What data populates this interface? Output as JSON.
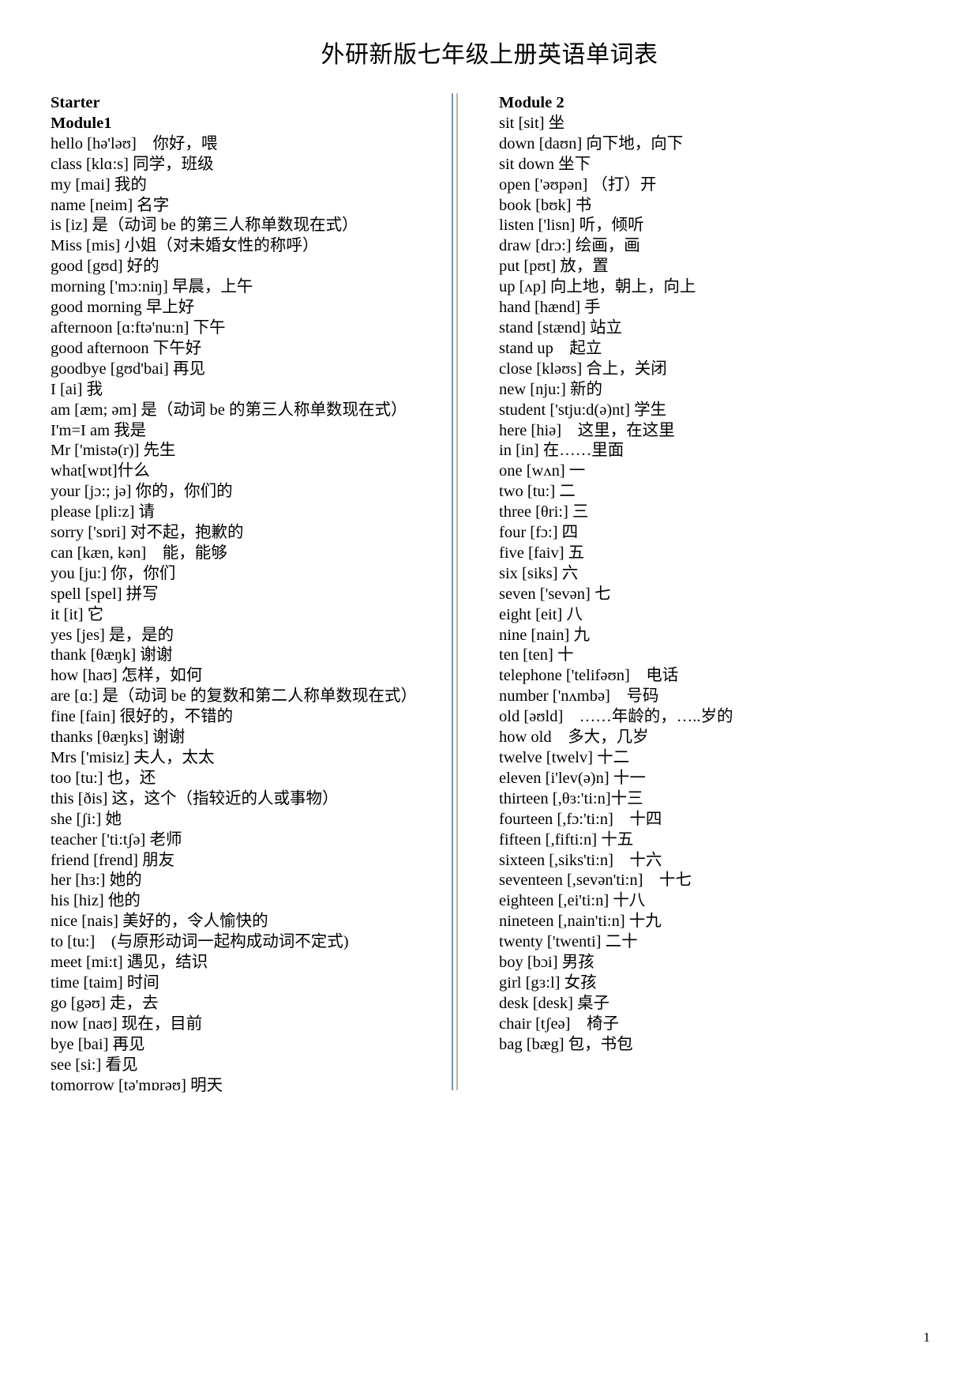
{
  "document": {
    "title": "外研新版七年级上册英语单词表",
    "page_number": "1",
    "divider_outer_color": "#6f96b8",
    "divider_inner_color": "#b4b4b4"
  },
  "left_column": {
    "headings": [
      "Starter",
      "Module1"
    ],
    "entries": [
      "hello [hə'ləʊ]　你好，喂",
      "class [klɑ:s] 同学，班级",
      "my [mai] 我的",
      "name [neim] 名字",
      "is [iz] 是（动词 be 的第三人称单数现在式）",
      "Miss [mis] 小姐（对未婚女性的称呼）",
      "good [gʊd] 好的",
      "morning ['mɔ:niŋ] 早晨，上午",
      "good morning 早上好",
      "afternoon [ɑ:ftə'nu:n] 下午",
      "good afternoon 下午好",
      "goodbye [gʊd'bai] 再见",
      "I [ai] 我",
      "am [æm; əm] 是（动词 be 的第三人称单数现在式）",
      "I'm=I am 我是",
      "Mr ['mistə(r)] 先生",
      "what[wɒt]什么",
      "your [jɔ:; jə] 你的，你们的",
      "please [pli:z] 请",
      "sorry ['sɒri] 对不起，抱歉的",
      "can [kæn, kən]　能，能够",
      "you [ju:] 你，你们",
      "spell [spel] 拼写",
      "it [it] 它",
      "yes [jes] 是，是的",
      "thank [θæŋk] 谢谢",
      "how [haʊ] 怎样，如何",
      "are [ɑ:] 是（动词 be 的复数和第二人称单数现在式）",
      "fine [fain] 很好的，不错的",
      "thanks [θæŋks] 谢谢",
      "Mrs ['misiz] 夫人，太太",
      "too [tu:] 也，还",
      "this [ðis] 这，这个（指较近的人或事物）",
      "she [ʃi:] 她",
      "teacher ['ti:tʃə] 老师",
      "friend [frend] 朋友",
      "her [hɜ:] 她的",
      "his [hiz] 他的",
      "nice [nais] 美好的，令人愉快的",
      "to [tu:]　(与原形动词一起构成动词不定式)",
      "meet [mi:t] 遇见，结识",
      "time [taim] 时间",
      "go [gəʊ] 走，去",
      "now [naʊ] 现在，目前",
      "bye [bai] 再见",
      "see [si:] 看见",
      "tomorrow [tə'mɒrəʊ] 明天"
    ]
  },
  "right_column": {
    "headings": [
      "Module 2"
    ],
    "entries": [
      "sit [sit] 坐",
      "down [daʊn] 向下地，向下",
      "sit down 坐下",
      "open ['əʊpən] （打）开",
      "book [bʊk] 书",
      "listen ['lisn] 听，倾听",
      "draw [drɔ:] 绘画，画",
      "put [pʊt] 放，置",
      "up [ʌp] 向上地，朝上，向上",
      "hand [hænd] 手",
      "stand [stænd] 站立",
      "stand up　起立",
      "close [kləʊs] 合上，关闭",
      "new [nju:] 新的",
      "student ['stju:d(ə)nt] 学生",
      "here [hiə]　这里，在这里",
      "in [in] 在……里面",
      "one [wʌn] 一",
      "two [tu:] 二",
      "three [θri:] 三",
      "four [fɔ:] 四",
      "five [faiv] 五",
      "six [siks] 六",
      "seven ['sevən] 七",
      "eight [eit] 八",
      "nine [nain] 九",
      "ten [ten] 十",
      "telephone ['telifəʊn]　电话",
      "number ['nʌmbə]　号码",
      "old [əʊld]　……年龄的，…..岁的",
      "how old　多大，几岁",
      "twelve [twelv] 十二",
      "eleven [i'lev(ə)n] 十一",
      "thirteen [,θɜ:'ti:n]十三",
      "fourteen [,fɔ:'ti:n]　十四",
      "fifteen [,fifti:n] 十五",
      "sixteen [,siks'ti:n]　十六",
      "seventeen [,sevən'ti:n]　十七",
      "eighteen [,ei'ti:n] 十八",
      "nineteen [,nain'ti:n] 十九",
      "twenty ['twenti] 二十",
      "boy [bɔi] 男孩",
      "girl [gɜ:l] 女孩",
      "desk [desk] 桌子",
      "chair [tʃeə]　椅子",
      "bag [bæg] 包，书包"
    ]
  }
}
